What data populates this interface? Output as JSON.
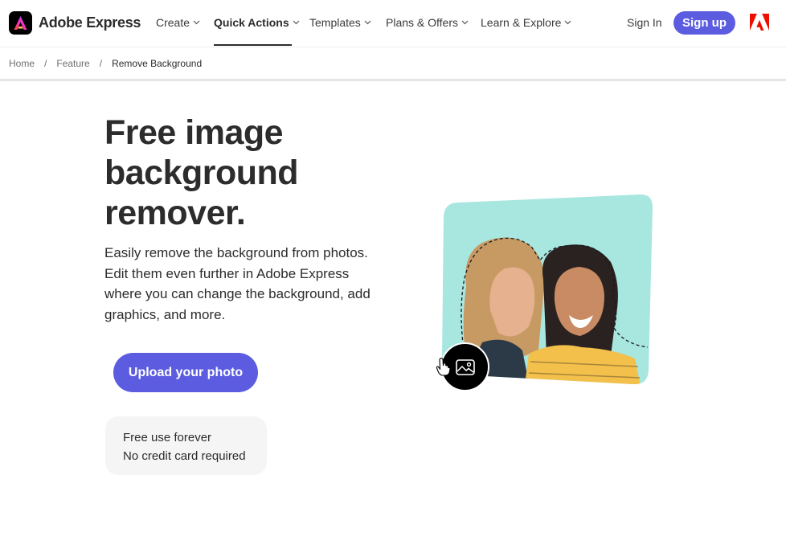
{
  "brand": {
    "name": "Adobe Express",
    "logo_icon": "adobe-express-logo-icon"
  },
  "nav": {
    "items": [
      {
        "label": "Create",
        "has_dropdown": true
      },
      {
        "label": "Quick Actions",
        "has_dropdown": true,
        "active": true
      },
      {
        "label": "Templates",
        "has_dropdown": true
      },
      {
        "label": "Plans & Offers",
        "has_dropdown": true
      },
      {
        "label": "Learn & Explore",
        "has_dropdown": true
      }
    ],
    "sign_in": "Sign In",
    "sign_up": "Sign up",
    "adobe_icon": "adobe-logo-icon"
  },
  "breadcrumb": {
    "items": [
      "Home",
      "Feature",
      "Remove Background"
    ],
    "separator": "/"
  },
  "hero": {
    "title_lines": [
      "Free image",
      "background",
      "remover."
    ],
    "description": "Easily remove the background from photos. Edit them even further in Adobe Express where you can change the background, add graphics, and more.",
    "upload_label": "Upload your photo",
    "perks": [
      "Free use forever",
      "No credit card required"
    ]
  },
  "illustration": {
    "icon": "image-icon",
    "cursor_icon": "hand-cursor-icon"
  },
  "colors": {
    "accent": "#5c5ce0",
    "text": "#2c2c2c",
    "photo_bg": "#a8e6e0",
    "adobe_red": "#eb1000"
  }
}
